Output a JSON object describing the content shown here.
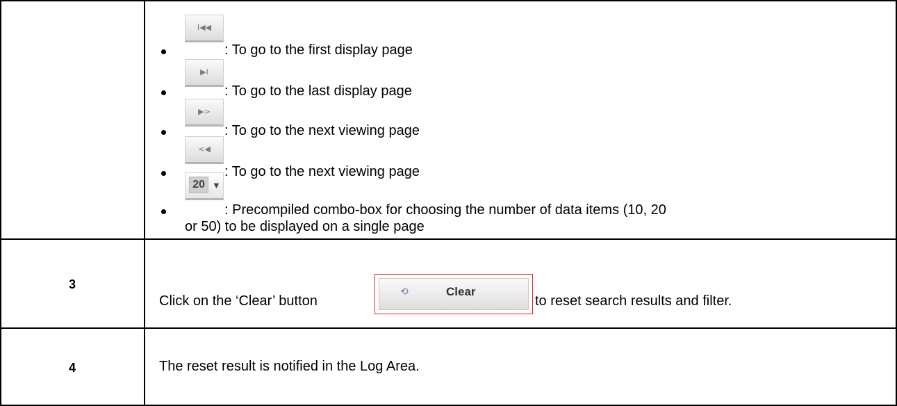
{
  "rows": {
    "nav_items": [
      {
        "icon": "first-page-icon",
        "glyph": "I◀◀",
        "text": ": To go to the first display page"
      },
      {
        "icon": "last-page-icon",
        "glyph": "▶I",
        "text": ": To go to the last display page"
      },
      {
        "icon": "next-page-icon",
        "glyph": "▶>",
        "text": ": To go to the next viewing page"
      },
      {
        "icon": "previous-page-icon",
        "glyph": "<◀",
        "text": ": To go to the next viewing page"
      }
    ],
    "combo": {
      "value": "20",
      "text_line1": ": Precompiled combo-box for choosing the number of data items  (10, 20",
      "text_line2": "or 50) to be displayed on a single page"
    },
    "step3": {
      "number": "3",
      "text_before": "Click on the ‘Clear’ button",
      "button_label": "Clear",
      "text_after": "to reset search results and filter."
    },
    "step4": {
      "number": "4",
      "text": "The reset result is notified in the Log Area."
    }
  }
}
